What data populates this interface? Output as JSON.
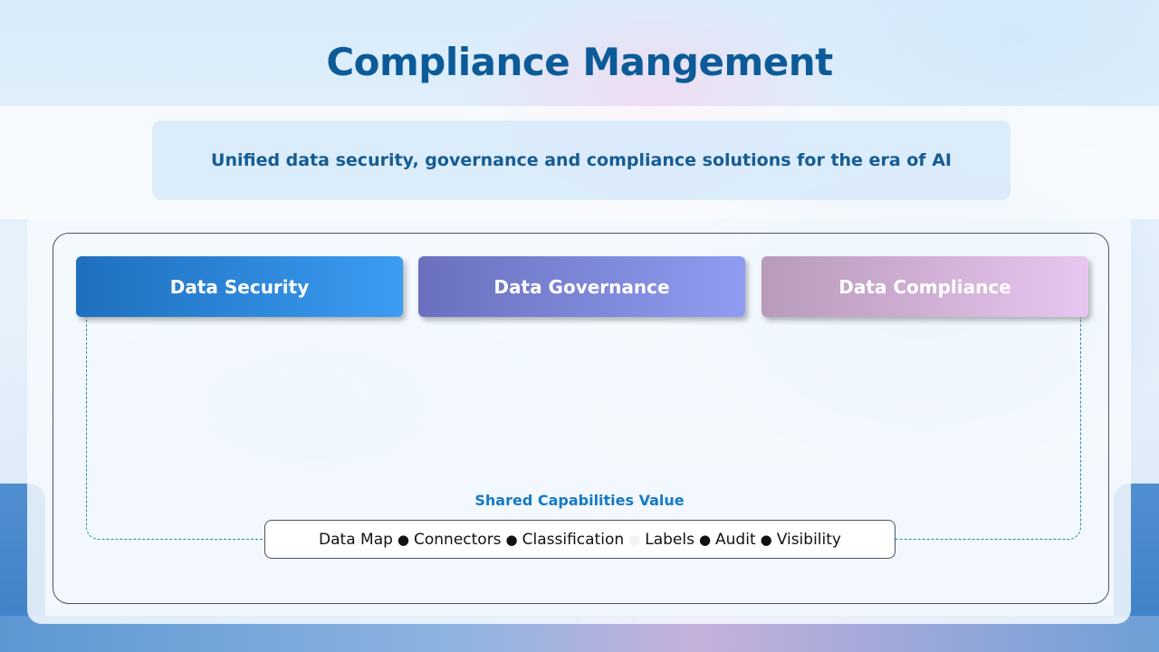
{
  "title": "Compliance Mangement",
  "subtitle": "Unified data security, governance and compliance solutions for the era of AI",
  "pillars": [
    {
      "label": "Data Security"
    },
    {
      "label": "Data Governance"
    },
    {
      "label": "Data Compliance"
    }
  ],
  "shared": {
    "label": "Shared Capabilities Value",
    "items": [
      "Data Map",
      "Connectors",
      "Classification",
      "Labels",
      "Audit",
      "Visibility"
    ],
    "separator": "●"
  },
  "colors": {
    "title": "#0c5b98",
    "security": "#2e86d8",
    "governance": "#7c86d8",
    "compliance": "#d4b2d8",
    "shared_label": "#1679c4",
    "connector_dash": "#2a8a9a"
  }
}
